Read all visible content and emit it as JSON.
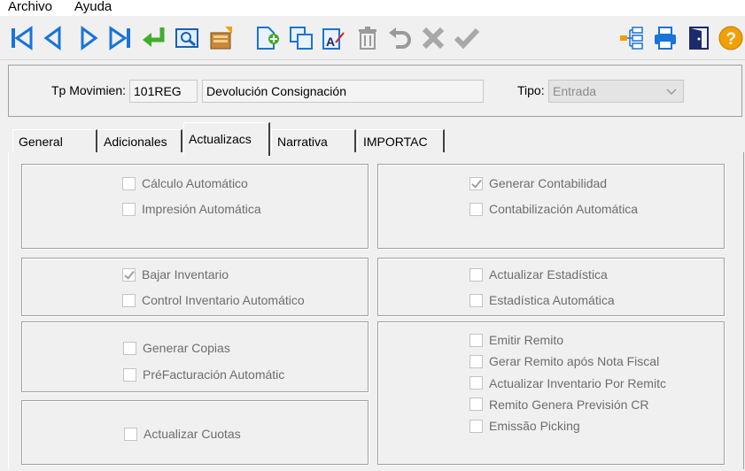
{
  "menu": {
    "items": [
      "Archivo",
      "Ayuda"
    ]
  },
  "toolbar": {
    "buttons": [
      "first-record-icon",
      "previous-record-icon",
      "next-record-icon",
      "last-record-icon",
      "enter-icon",
      "preview-icon",
      "edit-record-icon",
      "new-document-icon",
      "copy-icon",
      "rename-icon",
      "delete-icon",
      "undo-icon",
      "cancel-icon",
      "confirm-icon",
      "tree-icon",
      "print-icon",
      "exit-icon",
      "help-icon"
    ]
  },
  "header": {
    "tp_movimiento_label": "Tp Movimien:",
    "tp_code": "101REG",
    "tp_description": "Devolución Consignación",
    "tipo_label": "Tipo:",
    "tipo_value": "Entrada"
  },
  "tabs": [
    {
      "label": "General",
      "active": false
    },
    {
      "label": "Adicionales",
      "active": false
    },
    {
      "label": "Actualizacs",
      "active": true
    },
    {
      "label": "Narrativa",
      "active": false
    },
    {
      "label": "IMPORTAC",
      "active": false
    }
  ],
  "groups": {
    "calculo": [
      {
        "label": "Cálculo Automático",
        "checked": false
      },
      {
        "label": "Impresión Automática",
        "checked": false
      }
    ],
    "contabilidad": [
      {
        "label": "Generar Contabilidad",
        "checked": true
      },
      {
        "label": "Contabilización Automática",
        "checked": false
      }
    ],
    "inventario": [
      {
        "label": "Bajar Inventario",
        "checked": true
      },
      {
        "label": "Control Inventario Automático",
        "checked": false
      }
    ],
    "estadistica": [
      {
        "label": "Actualizar Estadística",
        "checked": false
      },
      {
        "label": "Estadística Automática",
        "checked": false
      }
    ],
    "copias": [
      {
        "label": "Generar Copias",
        "checked": false
      },
      {
        "label": "PréFacturación Automátic",
        "checked": false
      }
    ],
    "remito": [
      {
        "label": "Emitir Remito",
        "checked": false
      },
      {
        "label": "Gerar Remito após Nota Fiscal",
        "checked": false
      },
      {
        "label": "Actualizar Inventario Por Remitc",
        "checked": false
      },
      {
        "label": "Remito Genera Previsión CR",
        "checked": false
      },
      {
        "label": "Emissão Picking",
        "checked": false
      }
    ],
    "cuotas": [
      {
        "label": "Actualizar Cuotas",
        "checked": false
      }
    ]
  },
  "colors": {
    "nav_blue": "#1a73d9",
    "enter_green": "#3fae2a",
    "help_orange": "#f2a000",
    "disabled_text": "#6d6d6d"
  }
}
